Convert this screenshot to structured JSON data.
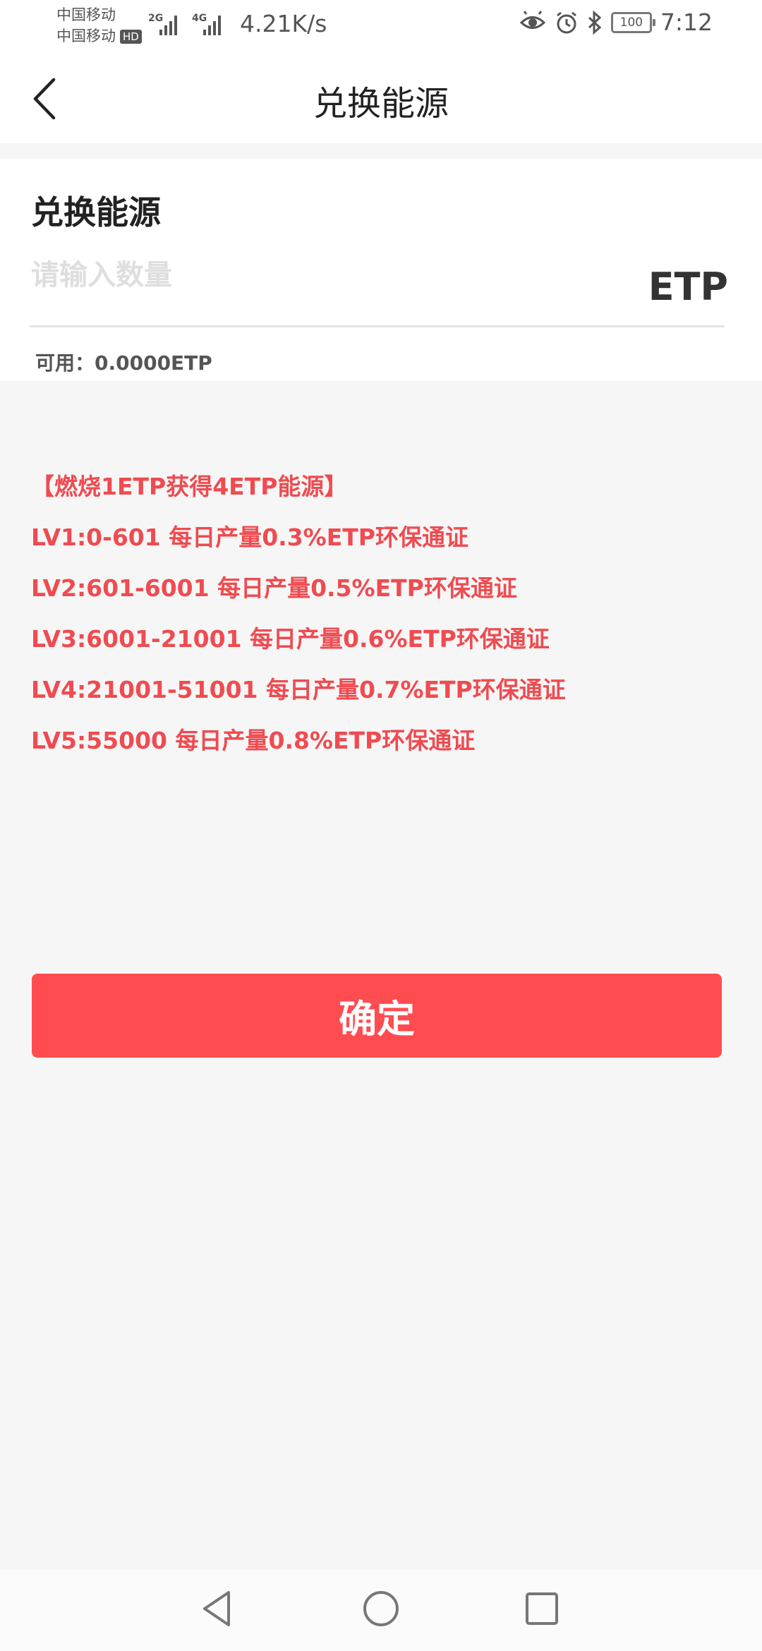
{
  "status_bar": {
    "carrier_1": "中国移动",
    "carrier_2": "中国移动",
    "hd_badge": "HD",
    "signal_1_tag": "2G",
    "signal_2_tag": "4G",
    "net_speed": "4.21K/s",
    "battery": "100",
    "time": "7:12",
    "icons": [
      "eye-comfort-icon",
      "alarm-icon",
      "bluetooth-icon"
    ]
  },
  "nav": {
    "title": "兑换能源",
    "back_icon": "chevron-left-icon"
  },
  "form": {
    "title": "兑换能源",
    "amount_placeholder": "请输入数量",
    "amount_value": "",
    "unit": "ETP",
    "available": "可用：0.0000ETP"
  },
  "rules": {
    "headline": "【燃烧1ETP获得4ETP能源】",
    "levels": [
      "LV1:0-601 每日产量0.3%ETP环保通证",
      "LV2:601-6001 每日产量0.5%ETP环保通证",
      "LV3:6001-21001 每日产量0.6%ETP环保通证",
      "LV4:21001-51001 每日产量0.7%ETP环保通证",
      "LV5:55000 每日产量0.8%ETP环保通证"
    ]
  },
  "confirm_label": "确定",
  "colors": {
    "accent": "#ff4c51",
    "rule_text": "#ef4b50",
    "page_bg": "#f6f6f6",
    "card_bg": "#ffffff"
  },
  "system_nav": [
    "back-triangle-icon",
    "home-circle-icon",
    "recents-square-icon"
  ]
}
